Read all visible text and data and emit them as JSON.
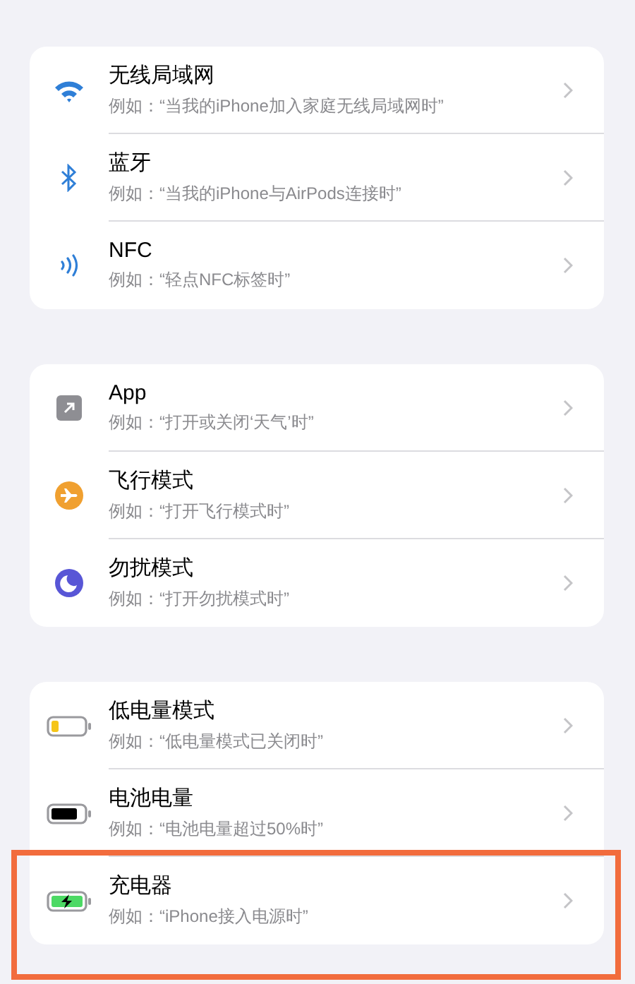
{
  "groups": [
    {
      "items": [
        {
          "kind": "wifi",
          "title": "无线局域网",
          "subtitle": "例如：“当我的iPhone加入家庭无线局域网时”",
          "highlighted": false
        },
        {
          "kind": "bluetooth",
          "title": "蓝牙",
          "subtitle": "例如：“当我的iPhone与AirPods连接时”",
          "highlighted": false
        },
        {
          "kind": "nfc",
          "title": "NFC",
          "subtitle": "例如：“轻点NFC标签时”",
          "highlighted": false
        }
      ]
    },
    {
      "items": [
        {
          "kind": "app",
          "title": "App",
          "subtitle": "例如：“打开或关闭‘天气’时”",
          "highlighted": false
        },
        {
          "kind": "airplane",
          "title": "飞行模式",
          "subtitle": "例如：“打开飞行模式时”",
          "highlighted": false
        },
        {
          "kind": "moon",
          "title": "勿扰模式",
          "subtitle": "例如：“打开勿扰模式时”",
          "highlighted": false
        }
      ]
    },
    {
      "items": [
        {
          "kind": "battery-low",
          "title": "低电量模式",
          "subtitle": "例如：“低电量模式已关闭时”",
          "highlighted": false
        },
        {
          "kind": "battery",
          "title": "电池电量",
          "subtitle": "例如：“电池电量超过50%时”",
          "highlighted": false
        },
        {
          "kind": "charger",
          "title": "充电器",
          "subtitle": "例如：“iPhone接入电源时”",
          "highlighted": true
        }
      ]
    }
  ]
}
